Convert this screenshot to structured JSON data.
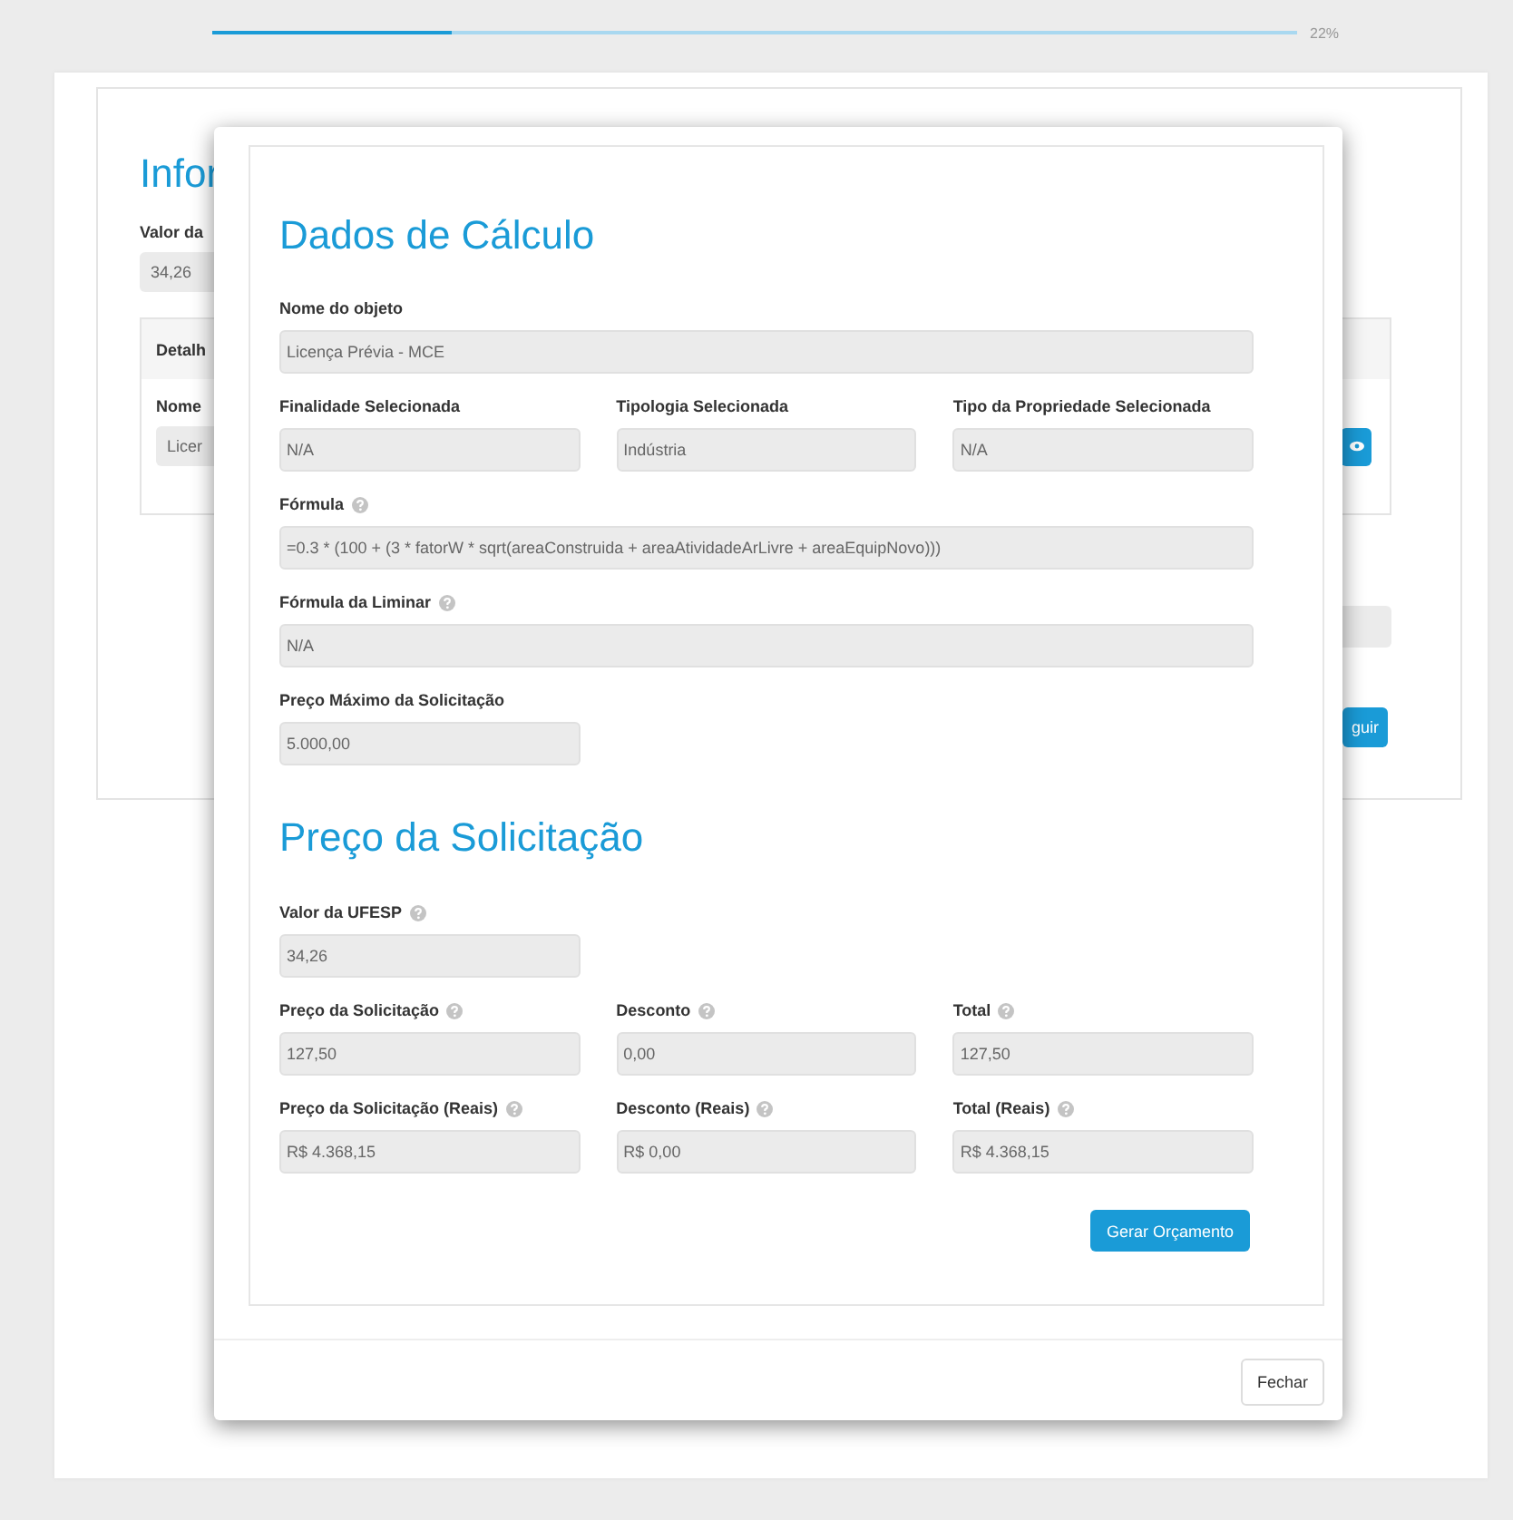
{
  "progress": {
    "level": 0.22,
    "reading": "22%"
  },
  "background": {
    "title": "Infor",
    "value_label": "Valor da",
    "value": "34,26",
    "panel_title": "Detalh",
    "name_label": "Nome",
    "name_value": "Licer",
    "next_button": "guir"
  },
  "modal": {
    "sections": [
      {
        "title": "Dados de Cálculo",
        "rows": [
          {
            "kind": "full",
            "fields": [
              {
                "label": "Nome do objeto",
                "value": "Licença Prévia - MCE",
                "help": false
              }
            ]
          },
          {
            "kind": "columns",
            "fields": [
              {
                "label": "Finalidade Selecionada",
                "value": "N/A",
                "help": false
              },
              {
                "label": "Tipologia Selecionada",
                "value": "Indústria",
                "help": false
              },
              {
                "label": "Tipo da Propriedade Selecionada",
                "value": "N/A",
                "help": false
              }
            ]
          },
          {
            "kind": "full",
            "fields": [
              {
                "label": "Fórmula",
                "value": "=0.3 * (100 + (3 * fatorW * sqrt(areaConstruida + areaAtividadeArLivre + areaEquipNovo)))",
                "help": true
              }
            ]
          },
          {
            "kind": "full",
            "fields": [
              {
                "label": "Fórmula da Liminar",
                "value": "N/A",
                "help": true
              }
            ]
          },
          {
            "kind": "columns",
            "fields": [
              {
                "label": "Preço Máximo da Solicitação",
                "value": "5.000,00",
                "help": false
              }
            ]
          }
        ]
      },
      {
        "title": "Preço da Solicitação",
        "rows": [
          {
            "kind": "columns",
            "fields": [
              {
                "label": "Valor da UFESP",
                "value": "34,26",
                "help": true
              }
            ]
          },
          {
            "kind": "columns",
            "fields": [
              {
                "label": "Preço da Solicitação",
                "value": "127,50",
                "help": true
              },
              {
                "label": "Desconto",
                "value": "0,00",
                "help": true
              },
              {
                "label": "Total",
                "value": "127,50",
                "help": true
              }
            ]
          },
          {
            "kind": "columns",
            "fields": [
              {
                "label": "Preço da Solicitação (Reais)",
                "value": "R$ 4.368,15",
                "help": true
              },
              {
                "label": "Desconto (Reais)",
                "value": "R$ 0,00",
                "help": true
              },
              {
                "label": "Total (Reais)",
                "value": "R$ 4.368,15",
                "help": true
              }
            ]
          }
        ]
      }
    ],
    "primary_button": "Gerar Orçamento",
    "close_button": "Fechar"
  }
}
